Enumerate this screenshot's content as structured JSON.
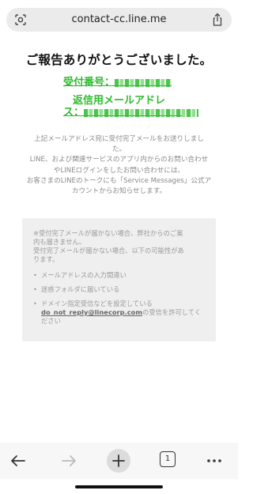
{
  "browser": {
    "url": "contact-cc.line.me",
    "lens_icon": "lens-icon",
    "share_icon": "share-icon"
  },
  "content": {
    "title": "ご報告ありがとうございました。",
    "receipt_label": "受付番号：",
    "reply_label_1": "返信用メールアドレ",
    "reply_label_2": "ス：",
    "description": [
      "上記メールアドレス宛に受付完了メールをお送りしまし",
      "た。",
      "LINE、および関連サービスのアプリ内からのお問い合わせ",
      "やLINEログインをしたお問い合わせには、",
      "お客さまのLINEのトークにも「Service Messages」公式ア",
      "カウントからお知らせします。"
    ]
  },
  "notice": {
    "lines": [
      "※受付完了メールが届かない場合、弊社からのご案",
      "内も届きません。",
      "受付完了メールが届かない場合、以下の可能性があ",
      "ります。"
    ],
    "bullets": [
      "メールアドレスの入力間違い",
      "迷惑フォルダに届いている",
      "ドメイン指定受信などを設定している"
    ],
    "link_text": "do_not_reply@linecorp.com",
    "after_link": "の受信を許可してく",
    "last_line": "ださい"
  },
  "toolbar": {
    "tab_count": "1",
    "icons": [
      "back-arrow-icon",
      "forward-arrow-icon",
      "new-tab-plus-icon",
      "tabs-icon",
      "more-icon"
    ]
  }
}
